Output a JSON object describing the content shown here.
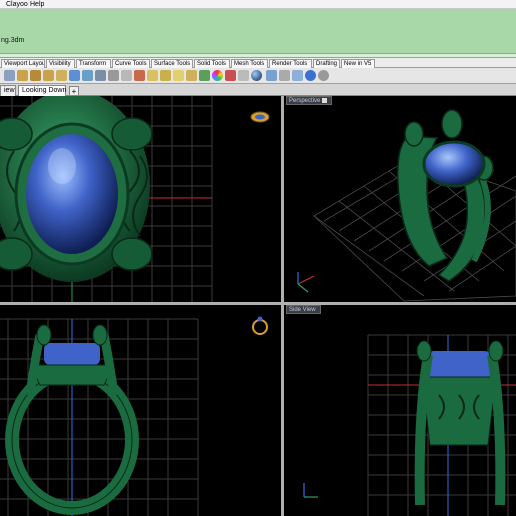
{
  "menu": {
    "items": [
      "Clayoo",
      "Help"
    ]
  },
  "command": {
    "history_line": "ng.3dm"
  },
  "toolbar_tabs": [
    "Viewport Layout",
    "Visibility",
    "Transform",
    "Curve Tools",
    "Surface Tools",
    "Solid Tools",
    "Mesh Tools",
    "Render Tools",
    "Drafting",
    "New in V5"
  ],
  "toolbar_icons": [
    "pan-icon",
    "zoom-extents-icon",
    "zoom-window-icon",
    "zoom-selected-icon",
    "zoom-icon",
    "rotate-view-icon",
    "undo-view-icon",
    "set-view-icon",
    "set-cplane-icon",
    "grid-icon",
    "show-objects-icon",
    "lock-icon",
    "properties-icon",
    "spotlight-icon",
    "render-preview-icon",
    "shaded-icon",
    "color-wheel-icon",
    "rendered-icon",
    "ghosted-icon",
    "sphere-icon",
    "layers-icon",
    "options-icon",
    "arrange-icon",
    "help-icon",
    "gear-icon"
  ],
  "viewport_tabs": {
    "items": [
      "iew",
      "Looking Down"
    ],
    "add_label": "+"
  },
  "viewports": {
    "top_left": {
      "label": ""
    },
    "top_right": {
      "label": "Perspective"
    },
    "bottom_left": {
      "label": ""
    },
    "bottom_right": {
      "label": "Side View"
    }
  },
  "colors": {
    "command_bg": "#a8d8a8",
    "viewport_bg": "#000000",
    "ring_green": "#1f7a4a",
    "gem_blue": "#3f63c8",
    "grid_line": "#3a3a3a",
    "axis_red": "#c03030",
    "axis_green": "#2aa05a",
    "axis_blue": "#2f6fe0"
  }
}
